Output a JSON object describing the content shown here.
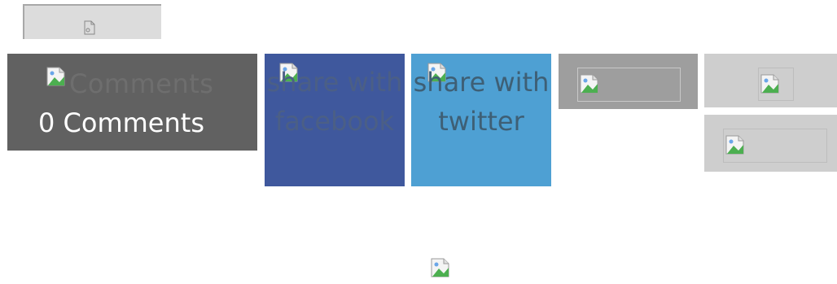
{
  "comments": {
    "image_alt": "Comments",
    "count_label": "0 Comments"
  },
  "share": {
    "facebook": {
      "image_alt": "share with facebook",
      "brand_color": "#3f589d"
    },
    "twitter": {
      "image_alt": "share with twitter",
      "brand_color": "#4ea0d3"
    }
  },
  "colors": {
    "comments_bg": "#616161",
    "button_grey": "#9e9e9e",
    "button_light_grey": "#cecece"
  },
  "icons": {
    "top_bar": "page-icon",
    "placeholders": "broken-image-icon"
  }
}
